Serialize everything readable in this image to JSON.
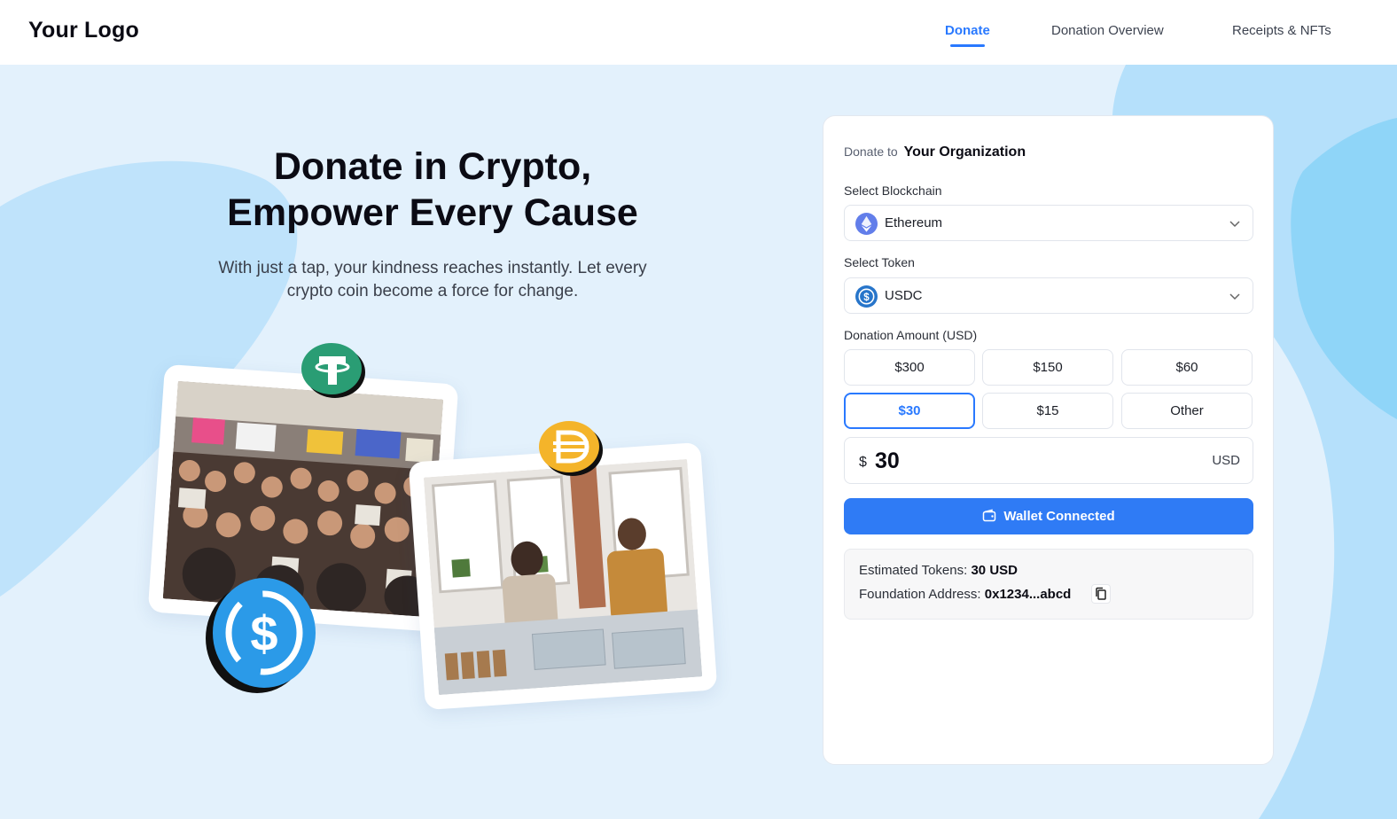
{
  "header": {
    "logo": "Your Logo",
    "nav": [
      {
        "label": "Donate",
        "active": true
      },
      {
        "label": "Donation Overview",
        "active": false
      },
      {
        "label": "Receipts & NFTs",
        "active": false
      }
    ]
  },
  "hero": {
    "title_line1": "Donate in Crypto,",
    "title_line2": "Empower Every Cause",
    "subtitle_line1": "With just a tap, your kindness reaches instantly. Let every",
    "subtitle_line2": "crypto coin become a force for change."
  },
  "coins": [
    "tether-icon",
    "dai-icon",
    "usdc-icon"
  ],
  "donate_form": {
    "donate_to_prefix": "Donate to",
    "organization": "Your Organization",
    "blockchain_label": "Select Blockchain",
    "blockchain_value": "Ethereum",
    "token_label": "Select Token",
    "token_value": "USDC",
    "amount_label": "Donation Amount (USD)",
    "amount_options": [
      "$300",
      "$150",
      "$60",
      "$30",
      "$15",
      "Other"
    ],
    "selected_amount": "$30",
    "amount_currency_symbol": "$",
    "amount_value": "30",
    "amount_unit": "USD",
    "wallet_button": "Wallet Connected",
    "estimated_label": "Estimated Tokens:",
    "estimated_value": "30 USD",
    "address_label": "Foundation Address:",
    "address_value": "0x1234...abcd"
  },
  "colors": {
    "accent": "#2979ff",
    "button": "#2f7bf5",
    "background": "#e3f1fc",
    "blob": "#b5e0fb"
  }
}
